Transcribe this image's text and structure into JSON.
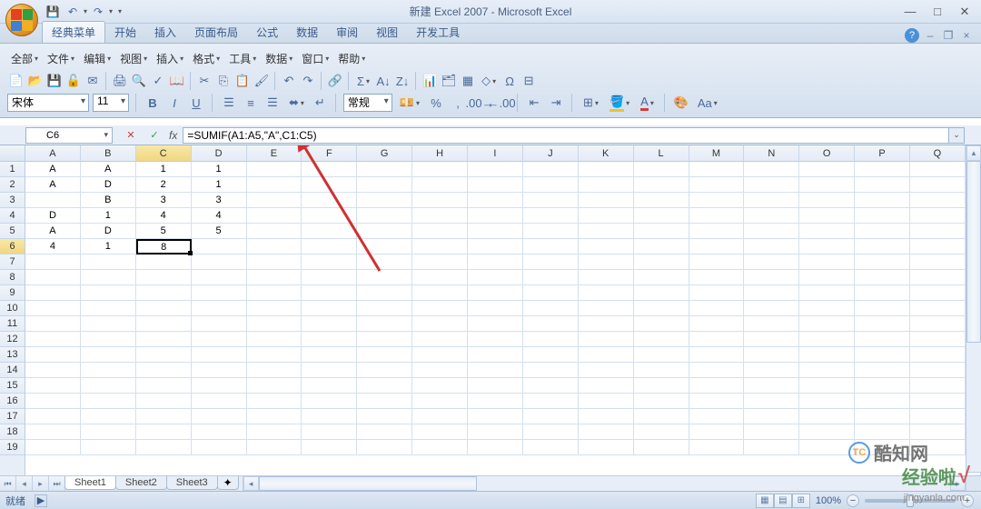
{
  "title": "新建 Excel 2007 - Microsoft Excel",
  "qat": {
    "save": "💾",
    "undo": "↶",
    "redo": "↷"
  },
  "win": {
    "min": "—",
    "max": "□",
    "close": "✕"
  },
  "doc_win": {
    "min": "–",
    "max": "❐",
    "close": "×"
  },
  "ribbon": {
    "tabs": [
      "经典菜单",
      "开始",
      "插入",
      "页面布局",
      "公式",
      "数据",
      "审阅",
      "视图",
      "开发工具"
    ],
    "active_index": 0,
    "help_icon": "?"
  },
  "menus": [
    "全部",
    "文件",
    "编辑",
    "视图",
    "插入",
    "格式",
    "工具",
    "数据",
    "窗口",
    "帮助"
  ],
  "font": {
    "name": "宋体",
    "size": "11"
  },
  "number_format": "常规",
  "name_box": "C6",
  "fx_label": "fx",
  "formula": "=SUMIF(A1:A5,\"A\",C1:C5)",
  "columns": [
    "A",
    "B",
    "C",
    "D",
    "E",
    "F",
    "G",
    "H",
    "I",
    "J",
    "K",
    "L",
    "M",
    "N",
    "O",
    "P",
    "Q"
  ],
  "row_count": 19,
  "active_cell": {
    "row": 6,
    "col": "C"
  },
  "data": {
    "1": {
      "A": "A",
      "B": "A",
      "C": "1",
      "D": "1"
    },
    "2": {
      "A": "A",
      "B": "D",
      "C": "2",
      "D": "1"
    },
    "3": {
      "A": "",
      "B": "B",
      "C": "3",
      "D": "3"
    },
    "4": {
      "A": "D",
      "B": "1",
      "C": "4",
      "D": "4"
    },
    "5": {
      "A": "A",
      "B": "D",
      "C": "5",
      "D": "5"
    },
    "6": {
      "A": "4",
      "B": "1",
      "C": "8"
    }
  },
  "sheets": [
    "Sheet1",
    "Sheet2",
    "Sheet3"
  ],
  "active_sheet": 0,
  "status": {
    "ready": "就绪",
    "zoom": "100%"
  },
  "watermark1": "酷知网",
  "watermark1_logo": "TC",
  "watermark2": "经验啦",
  "watermark2_url": "jingyanla.com"
}
